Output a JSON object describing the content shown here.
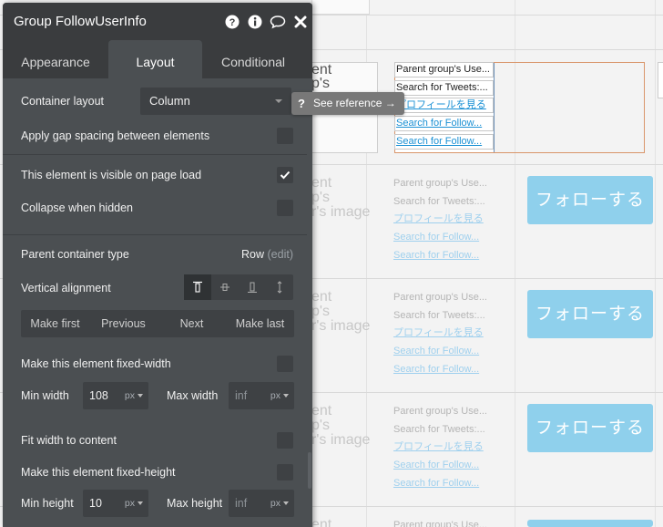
{
  "panel": {
    "title": "Group FollowUserInfo",
    "tabs": [
      {
        "label": "Appearance",
        "active": false
      },
      {
        "label": "Layout",
        "active": true
      },
      {
        "label": "Conditional",
        "active": false
      }
    ],
    "container_layout": {
      "label": "Container layout",
      "value": "Column"
    },
    "apply_gap": {
      "label": "Apply gap spacing between elements",
      "checked": false
    },
    "visible_on_load": {
      "label": "This element is visible on page load",
      "checked": true
    },
    "collapse_hidden": {
      "label": "Collapse when hidden",
      "checked": false
    },
    "parent_container": {
      "label": "Parent container type",
      "value": "Row",
      "edit": "(edit)"
    },
    "vertical_alignment": {
      "label": "Vertical alignment",
      "selected": "top"
    },
    "order_buttons": [
      "Make first",
      "Previous",
      "Next",
      "Make last"
    ],
    "fixed_width": {
      "label": "Make this element fixed-width",
      "checked": false
    },
    "min_width": {
      "label": "Min width",
      "value": "108",
      "unit": "px"
    },
    "max_width": {
      "label": "Max width",
      "placeholder": "inf",
      "unit": "px"
    },
    "fit_width": {
      "label": "Fit width to content",
      "checked": false
    },
    "fixed_height": {
      "label": "Make this element fixed-height",
      "checked": false
    },
    "min_height": {
      "label": "Min height",
      "value": "10",
      "unit": "px"
    },
    "max_height": {
      "label": "Max height",
      "placeholder": "inf",
      "unit": "px"
    }
  },
  "tooltip": {
    "icon": "?",
    "text": "See reference →"
  },
  "canvas": {
    "image_text": [
      "ent",
      "p's",
      "r's image"
    ],
    "selected_rows": [
      "Parent group's Use...",
      "Search for Tweets:...",
      "プロフィールを見る",
      "Search for Follow...",
      "Search for Follow..."
    ],
    "rows": [
      "Parent group's Use...",
      "Search for Tweets:...",
      "プロフィールを見る",
      "Search for Follow...",
      "Search for Follow..."
    ],
    "follow_button": "フォローする",
    "partial_row": "Parent group's Use..."
  },
  "colors": {
    "panel_bg": "#4b4f52",
    "header_bg": "#3a3c3e",
    "follow_button": "#8fd0ec",
    "selection": "#d9956a",
    "link": "#1a90d4"
  }
}
